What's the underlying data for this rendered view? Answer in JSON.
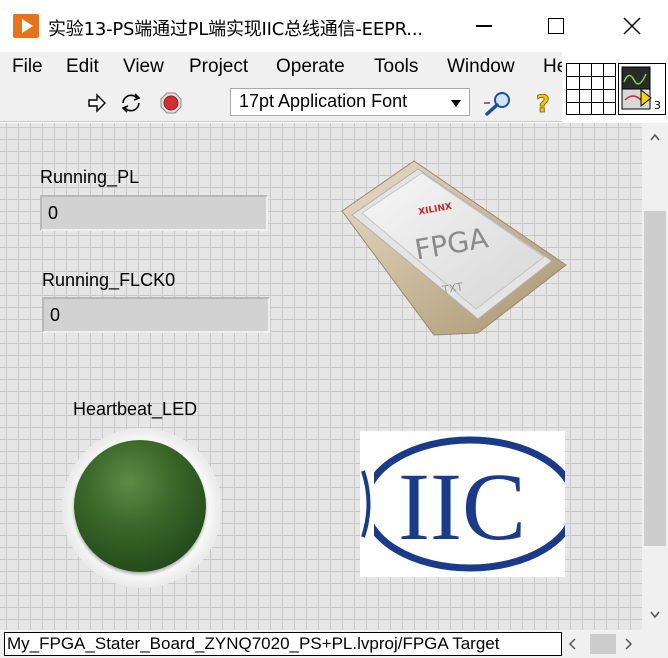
{
  "window": {
    "title": "实验13-PS端通过PL端实现IIC总线通信-EEPR..."
  },
  "menu": {
    "items": [
      "File",
      "Edit",
      "View",
      "Project",
      "Operate",
      "Tools",
      "Window",
      "He"
    ]
  },
  "toolbar": {
    "run_icon": "run-arrow-icon",
    "run_continuous_icon": "run-continuously-icon",
    "abort_icon": "abort-stop-icon",
    "font_select": "17pt Application Font",
    "search_icon": "magnifier-icon",
    "help_icon": "help-question-icon"
  },
  "controls": {
    "running_pl": {
      "label": "Running_PL",
      "value": "0"
    },
    "running_flck0": {
      "label": "Running_FLCK0",
      "value": "0"
    },
    "heartbeat_led": {
      "label": "Heartbeat_LED",
      "state": "off",
      "color": "#2e5a22"
    }
  },
  "images": {
    "fpga_chip": {
      "brand": "XILINX",
      "text": "FPGA",
      "sub": "TXT"
    },
    "iic_logo": {
      "text": "IIC",
      "color": "#1a3a8a"
    }
  },
  "statusbar": {
    "path": "My_FPGA_Stater_Board_ZYNQ7020_PS+PL.lvproj/FPGA Target"
  },
  "connector": {
    "icon_number": "3"
  },
  "colors": {
    "panel_bg": "#e6e6e6",
    "grid_line": "#c9c9c9",
    "app_icon": "#e8731a",
    "abort_red": "#d03030"
  }
}
